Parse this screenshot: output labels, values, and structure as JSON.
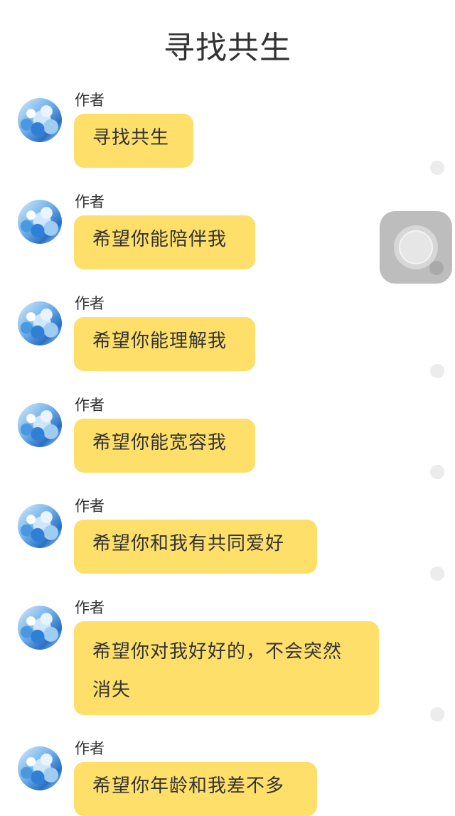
{
  "header": {
    "title": "寻找共生"
  },
  "messages": [
    {
      "author": "作者",
      "text": "寻找共生"
    },
    {
      "author": "作者",
      "text": "希望你能陪伴我"
    },
    {
      "author": "作者",
      "text": "希望你能理解我"
    },
    {
      "author": "作者",
      "text": "希望你能宽容我"
    },
    {
      "author": "作者",
      "text": "希望你和我有共同爱好"
    },
    {
      "author": "作者",
      "text": "希望你对我好好的，不会突然消失"
    },
    {
      "author": "作者",
      "text": "希望你年龄和我差不多"
    }
  ],
  "icons": {
    "avatar": "avatar-image",
    "floating_button": "assistive-touch-icon"
  },
  "colors": {
    "bubble": "#fddf6a",
    "text": "#333333",
    "background": "#ffffff"
  }
}
